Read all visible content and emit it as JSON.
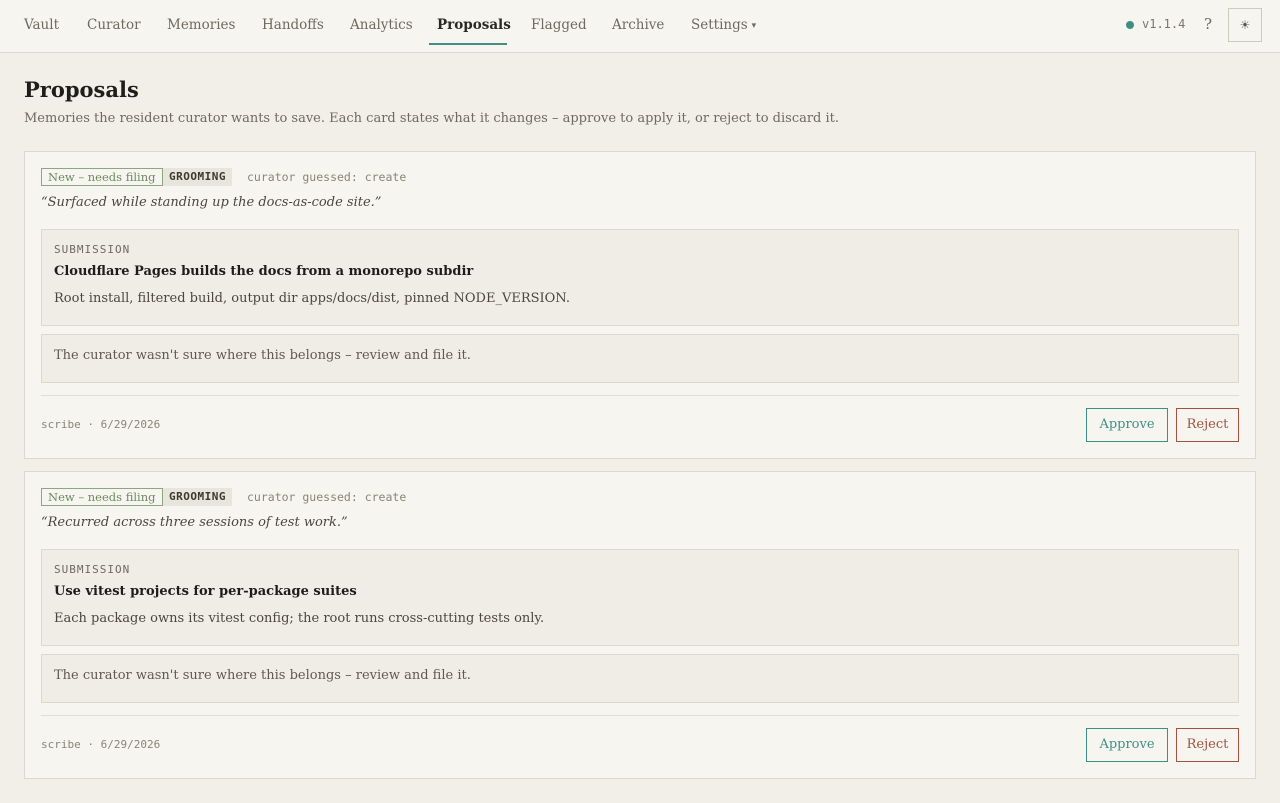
{
  "nav": {
    "items": [
      {
        "label": "Vault"
      },
      {
        "label": "Curator"
      },
      {
        "label": "Memories"
      },
      {
        "label": "Handoffs"
      },
      {
        "label": "Analytics"
      },
      {
        "label": "Proposals"
      },
      {
        "label": "Flagged"
      },
      {
        "label": "Archive"
      },
      {
        "label": "Settings"
      }
    ],
    "active": "Proposals",
    "version": "v1.1.4",
    "help": "?",
    "theme_icon": "sun-icon",
    "status_color": "#3f8f86"
  },
  "page": {
    "title": "Proposals",
    "subtitle": "Memories the resident curator wants to save. Each card states what it changes – approve to apply it, or reject to discard it."
  },
  "proposals": [
    {
      "status": "New – needs filing",
      "group": "GROOMING",
      "guess": "curator guessed: create",
      "quote": "“Surfaced while standing up the docs-as-code site.”",
      "submission_label": "SUBMISSION",
      "title": "Cloudflare Pages builds the docs from a monorepo subdir",
      "body": "Root install, filtered build, output dir apps/docs/dist, pinned NODE_VERSION.",
      "note": "The curator wasn't sure where this belongs – review and file it.",
      "meta": "scribe · 6/29/2026",
      "approve": "Approve",
      "reject": "Reject"
    },
    {
      "status": "New – needs filing",
      "group": "GROOMING",
      "guess": "curator guessed: create",
      "quote": "“Recurred across three sessions of test work.”",
      "submission_label": "SUBMISSION",
      "title": "Use vitest projects for per-package suites",
      "body": "Each package owns its vitest config; the root runs cross-cutting tests only.",
      "note": "The curator wasn't sure where this belongs – review and file it.",
      "meta": "scribe · 6/29/2026",
      "approve": "Approve",
      "reject": "Reject"
    }
  ],
  "colors": {
    "accent": "#3f8f86",
    "reject": "#a0523d",
    "background": "#f1efe8",
    "card": "#f7f5ef"
  }
}
